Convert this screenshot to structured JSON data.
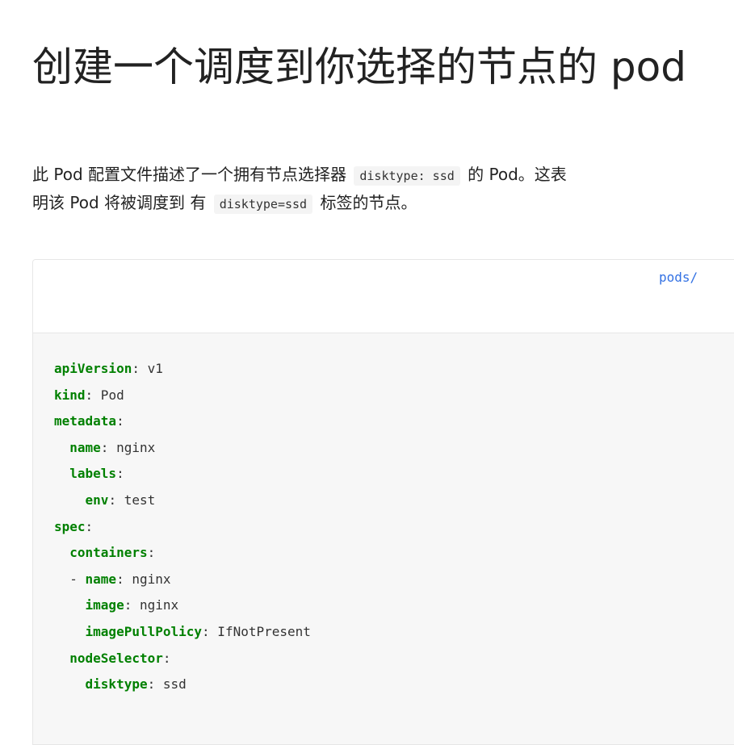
{
  "page_title": "创建一个调度到你选择的节点的 pod",
  "intro": {
    "line1_before": "此 Pod 配置文件描述了一个拥有节点选择器",
    "line1_code": "disktype: ssd",
    "line1_after": "的 Pod。这表",
    "line2_before": "明该 Pod 将被调度到 有",
    "line2_code": "disktype=ssd",
    "line2_after": "标签的节点。"
  },
  "code_file_link": "pods/",
  "code_lines": [
    {
      "indent": "",
      "key": "apiVersion",
      "value": " v1"
    },
    {
      "indent": "",
      "key": "kind",
      "value": " Pod"
    },
    {
      "indent": "",
      "key": "metadata",
      "value": ""
    },
    {
      "indent": "  ",
      "key": "name",
      "value": " nginx"
    },
    {
      "indent": "  ",
      "key": "labels",
      "value": ""
    },
    {
      "indent": "    ",
      "key": "env",
      "value": " test"
    },
    {
      "indent": "",
      "key": "spec",
      "value": ""
    },
    {
      "indent": "  ",
      "key": "containers",
      "value": ""
    },
    {
      "indent": "  - ",
      "key": "name",
      "value": " nginx"
    },
    {
      "indent": "    ",
      "key": "image",
      "value": " nginx"
    },
    {
      "indent": "    ",
      "key": "imagePullPolicy",
      "value": " IfNotPresent"
    },
    {
      "indent": "  ",
      "key": "nodeSelector",
      "value": ""
    },
    {
      "indent": "    ",
      "key": "disktype",
      "value": " ssd"
    }
  ],
  "highlight_color": "#f8d7e0",
  "link_color": "#3371e3",
  "key_color": "#008000"
}
